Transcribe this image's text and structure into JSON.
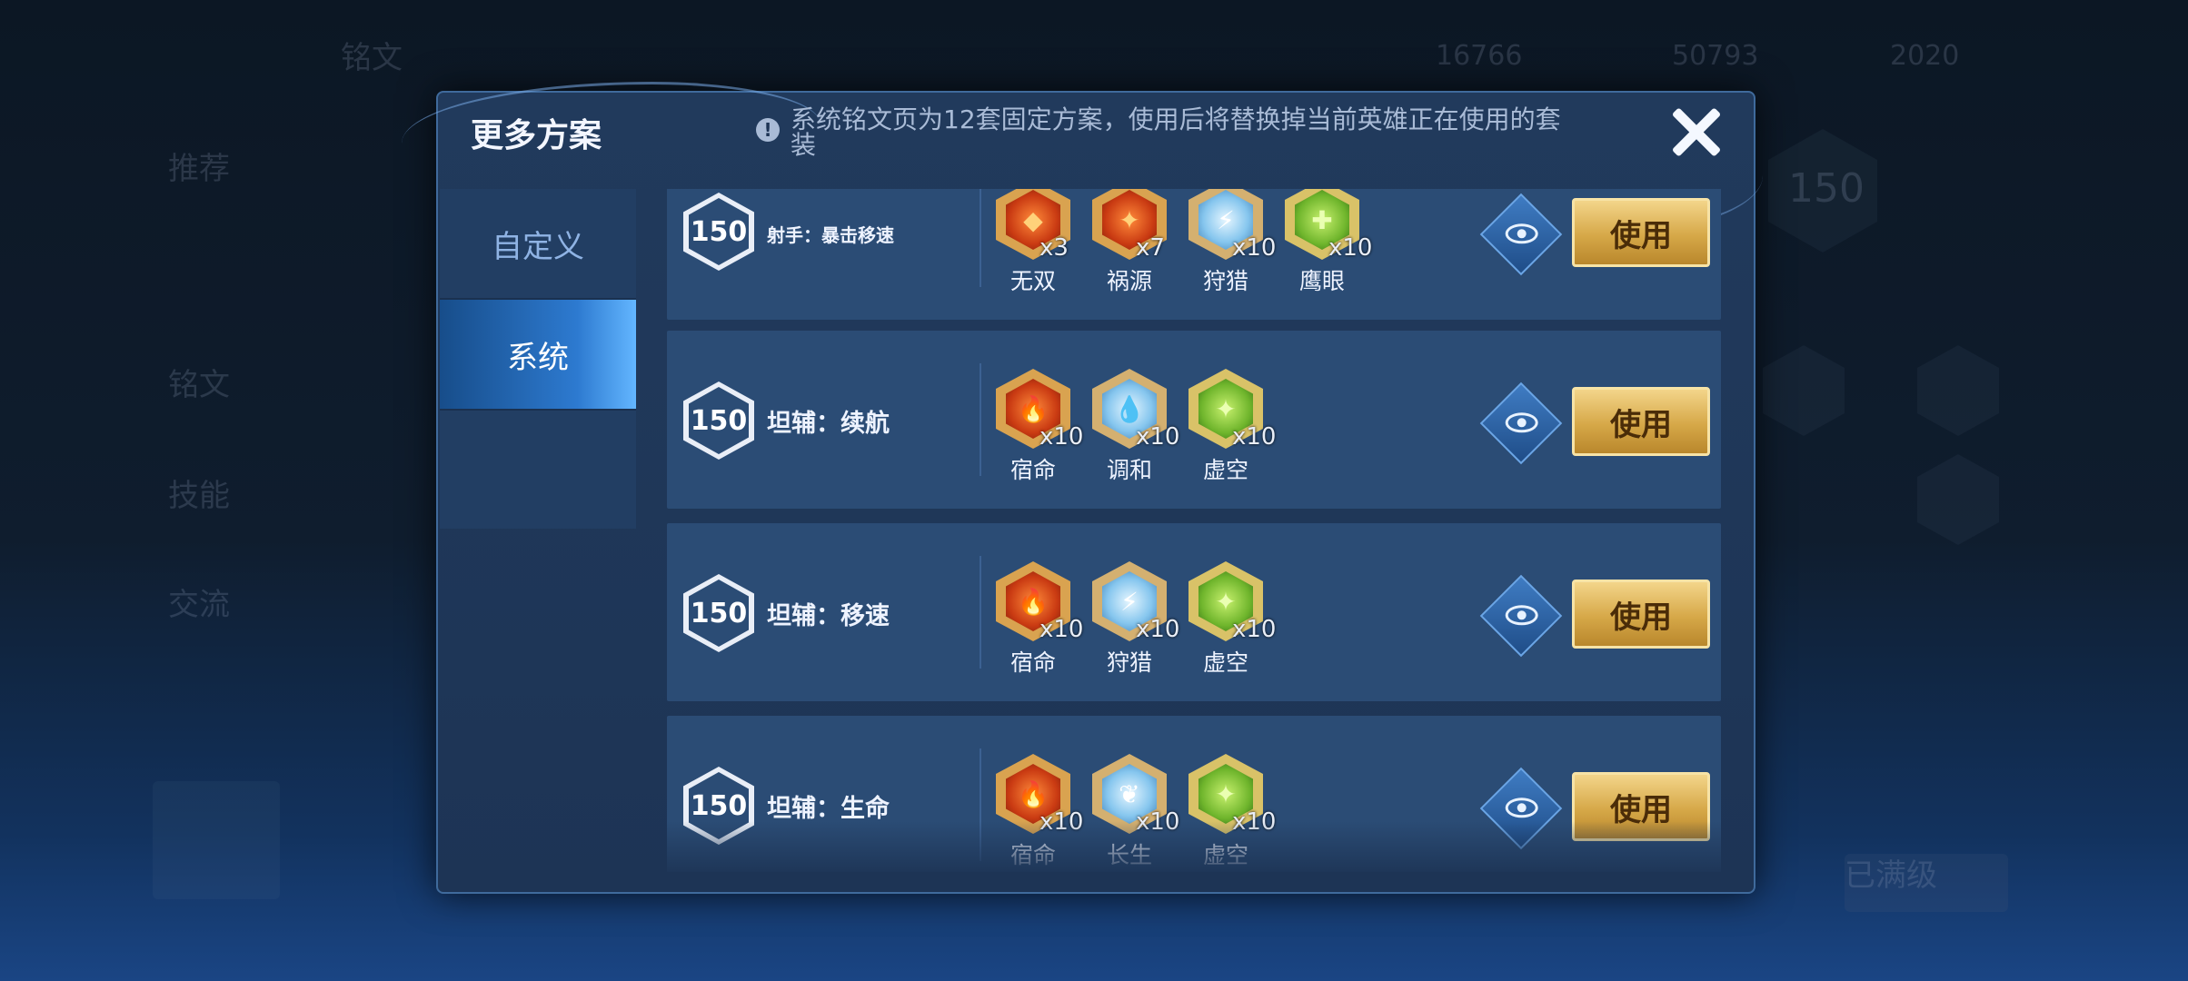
{
  "background": {
    "items": [
      "铭文",
      "推荐",
      "铭文",
      "技能",
      "交流",
      "已满级",
      "150"
    ],
    "currency": [
      "16766",
      "50793",
      "2020"
    ]
  },
  "modal": {
    "title": "更多方案",
    "notice": "系统铭文页为12套固定方案，使用后将替换掉当前英雄正在使用的套装",
    "tabs": [
      {
        "label": "自定义",
        "active": false
      },
      {
        "label": "系统",
        "active": true
      }
    ],
    "use_label": "使用",
    "rows": [
      {
        "level": "150",
        "name": "射手：暴击移速",
        "runes": [
          {
            "name": "无双",
            "count": "x3",
            "color": "red"
          },
          {
            "name": "祸源",
            "count": "x7",
            "color": "red"
          },
          {
            "name": "狩猎",
            "count": "x10",
            "color": "blue"
          },
          {
            "name": "鹰眼",
            "count": "x10",
            "color": "green"
          }
        ]
      },
      {
        "level": "150",
        "name": "坦辅：续航",
        "runes": [
          {
            "name": "宿命",
            "count": "x10",
            "color": "red"
          },
          {
            "name": "调和",
            "count": "x10",
            "color": "blue"
          },
          {
            "name": "虚空",
            "count": "x10",
            "color": "green"
          }
        ]
      },
      {
        "level": "150",
        "name": "坦辅：移速",
        "runes": [
          {
            "name": "宿命",
            "count": "x10",
            "color": "red"
          },
          {
            "name": "狩猎",
            "count": "x10",
            "color": "blue"
          },
          {
            "name": "虚空",
            "count": "x10",
            "color": "green"
          }
        ]
      },
      {
        "level": "150",
        "name": "坦辅：生命",
        "runes": [
          {
            "name": "宿命",
            "count": "x10",
            "color": "red"
          },
          {
            "name": "长生",
            "count": "x10",
            "color": "blue"
          },
          {
            "name": "虚空",
            "count": "x10",
            "color": "green"
          }
        ]
      }
    ]
  },
  "icons": {
    "close": "close-icon",
    "info": "info-icon",
    "preview": "eye-icon"
  },
  "colors": {
    "accent": "#2d7ad0",
    "button_gold": "#d6a848",
    "panel": "#2b4c75"
  }
}
